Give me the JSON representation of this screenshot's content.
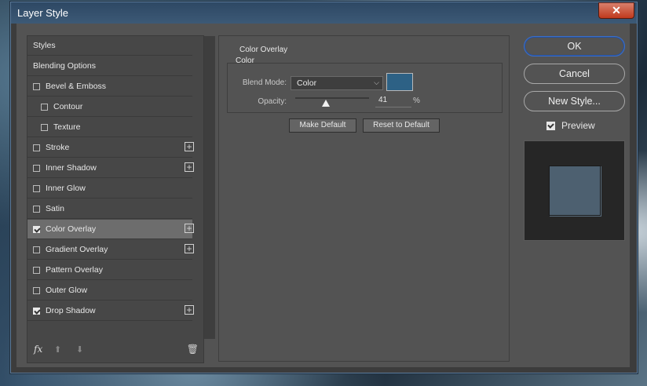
{
  "window": {
    "title": "Layer Style",
    "close_glyph": "✕"
  },
  "styles_panel": {
    "items": [
      {
        "label": "Styles",
        "checkbox": false,
        "checked": false,
        "indent": 0,
        "plus": false,
        "active": false
      },
      {
        "label": "Blending Options",
        "checkbox": false,
        "checked": false,
        "indent": 0,
        "plus": false,
        "active": false
      },
      {
        "label": "Bevel & Emboss",
        "checkbox": true,
        "checked": false,
        "indent": 0,
        "plus": false,
        "active": false
      },
      {
        "label": "Contour",
        "checkbox": true,
        "checked": false,
        "indent": 1,
        "plus": false,
        "active": false
      },
      {
        "label": "Texture",
        "checkbox": true,
        "checked": false,
        "indent": 1,
        "plus": false,
        "active": false
      },
      {
        "label": "Stroke",
        "checkbox": true,
        "checked": false,
        "indent": 0,
        "plus": true,
        "active": false
      },
      {
        "label": "Inner Shadow",
        "checkbox": true,
        "checked": false,
        "indent": 0,
        "plus": true,
        "active": false
      },
      {
        "label": "Inner Glow",
        "checkbox": true,
        "checked": false,
        "indent": 0,
        "plus": false,
        "active": false
      },
      {
        "label": "Satin",
        "checkbox": true,
        "checked": false,
        "indent": 0,
        "plus": false,
        "active": false
      },
      {
        "label": "Color Overlay",
        "checkbox": true,
        "checked": true,
        "indent": 0,
        "plus": true,
        "active": true
      },
      {
        "label": "Gradient Overlay",
        "checkbox": true,
        "checked": false,
        "indent": 0,
        "plus": true,
        "active": false
      },
      {
        "label": "Pattern Overlay",
        "checkbox": true,
        "checked": false,
        "indent": 0,
        "plus": false,
        "active": false
      },
      {
        "label": "Outer Glow",
        "checkbox": true,
        "checked": false,
        "indent": 0,
        "plus": false,
        "active": false
      },
      {
        "label": "Drop Shadow",
        "checkbox": true,
        "checked": true,
        "indent": 0,
        "plus": true,
        "active": false
      }
    ],
    "footer": {
      "fx": "fx",
      "up_glyph": "⬆",
      "down_glyph": "⬇",
      "trash_glyph": "🗑"
    }
  },
  "color_overlay": {
    "group_title": "Color Overlay",
    "sub_title": "Color",
    "blend_mode_label": "Blend Mode:",
    "blend_mode_value": "Color",
    "overlay_color": "#2d6185",
    "opacity_label": "Opacity:",
    "opacity_value": "41",
    "opacity_fraction": 0.41,
    "opacity_unit": "%",
    "make_default": "Make Default",
    "reset_default": "Reset to Default"
  },
  "actions": {
    "ok": "OK",
    "cancel": "Cancel",
    "new_style": "New Style...",
    "preview_label": "Preview",
    "preview_checked": true
  },
  "preview": {
    "swatch_color": "#4d6070"
  }
}
